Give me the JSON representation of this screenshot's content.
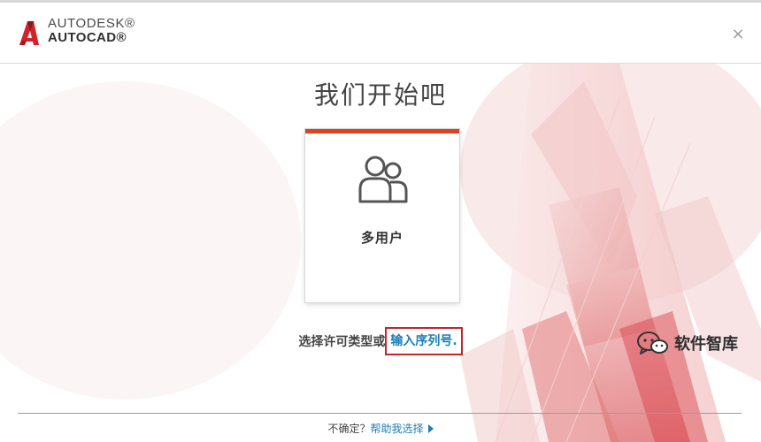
{
  "header": {
    "brand_line1": "AUTODESK®",
    "brand_line2": "AUTOCAD®",
    "close_glyph": "×",
    "logo_icon": "autocad-a-logo-icon",
    "close_icon": "close-icon"
  },
  "main": {
    "title": "我们开始吧",
    "license_card": {
      "label": "多用户",
      "icon": "multi-user-icon",
      "accent_color": "#e0421f"
    },
    "license_prompt": "选择许可类型或",
    "serial_link": "输入序列号."
  },
  "footer": {
    "question": "不确定？",
    "help_link": "帮助我选择",
    "help_icon": "play-triangle-icon"
  },
  "watermark": {
    "text": "软件智库",
    "icon": "wechat-icon"
  },
  "colors": {
    "accent": "#e0421f",
    "link": "#1b7fb7",
    "highlight_box": "#c6232b"
  }
}
